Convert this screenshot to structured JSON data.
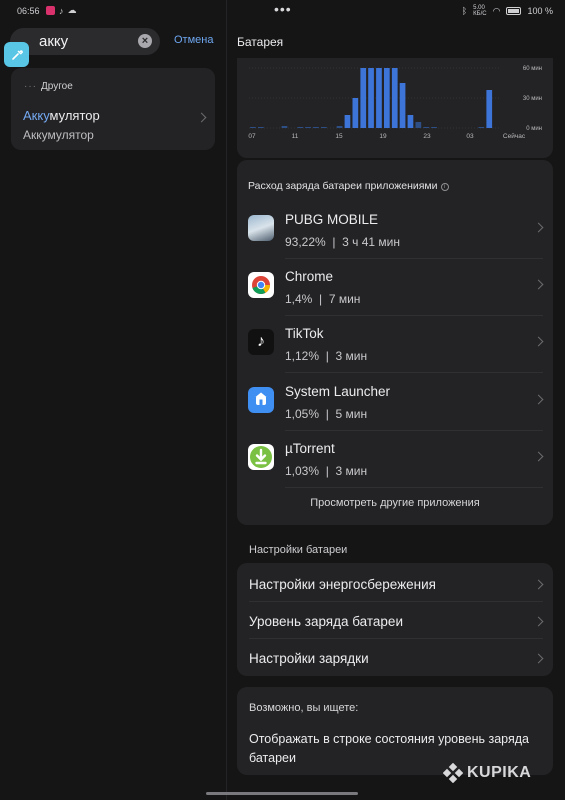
{
  "status_bar": {
    "time": "06:56",
    "right_text": "5.00\nКБ/С",
    "battery": "100 %"
  },
  "search": {
    "query": "акку",
    "cancel_label": "Отмена"
  },
  "results": {
    "category": "Другое",
    "title_highlight": "Акку",
    "title_rest": "мулятор",
    "subtitle": "Аккумулятор"
  },
  "page": {
    "title": "Батарея"
  },
  "chart_data": {
    "type": "bar",
    "ylabel_ticks": [
      "60 мин",
      "30 мин",
      "0 мин"
    ],
    "ylim": [
      0,
      60
    ],
    "xtick_labels": [
      "07",
      "11",
      "15",
      "19",
      "23",
      "03",
      "Сейчас"
    ],
    "values": [
      1,
      1,
      0,
      0,
      2,
      0,
      1,
      1,
      1,
      1,
      0,
      2,
      13,
      30,
      60,
      60,
      60,
      60,
      60,
      45,
      13,
      6,
      1,
      1,
      0,
      0,
      0,
      0,
      0,
      1,
      38,
      0
    ],
    "colors": {
      "bar": "#3d74d8",
      "bar_dim": "#2d4f86",
      "grid": "#3a3a3d"
    }
  },
  "apps_section": {
    "label": "Расход заряда батареи приложениями",
    "apps": [
      {
        "name": "PUBG MOBILE",
        "percent": "93,22%",
        "time": "3 ч 41 мин",
        "icon": "pubg-icon"
      },
      {
        "name": "Chrome",
        "percent": "1,4%",
        "time": "7 мин",
        "icon": "chrome-icon"
      },
      {
        "name": "TikTok",
        "percent": "1,12%",
        "time": "3 мин",
        "icon": "tiktok-icon"
      },
      {
        "name": "System Launcher",
        "percent": "1,05%",
        "time": "5 мин",
        "icon": "launcher-icon"
      },
      {
        "name": "µTorrent",
        "percent": "1,03%",
        "time": "3 мин",
        "icon": "utorrent-icon"
      }
    ],
    "more_label": "Просмотреть другие приложения"
  },
  "settings_section": {
    "label": "Настройки батареи",
    "items": [
      "Настройки энергосбережения",
      "Уровень заряда батареи",
      "Настройки зарядки"
    ]
  },
  "suggest": {
    "head": "Возможно, вы ищете:",
    "body": "Отображать в строке состояния уровень заряда батареи"
  },
  "watermark": "KUPIKA"
}
